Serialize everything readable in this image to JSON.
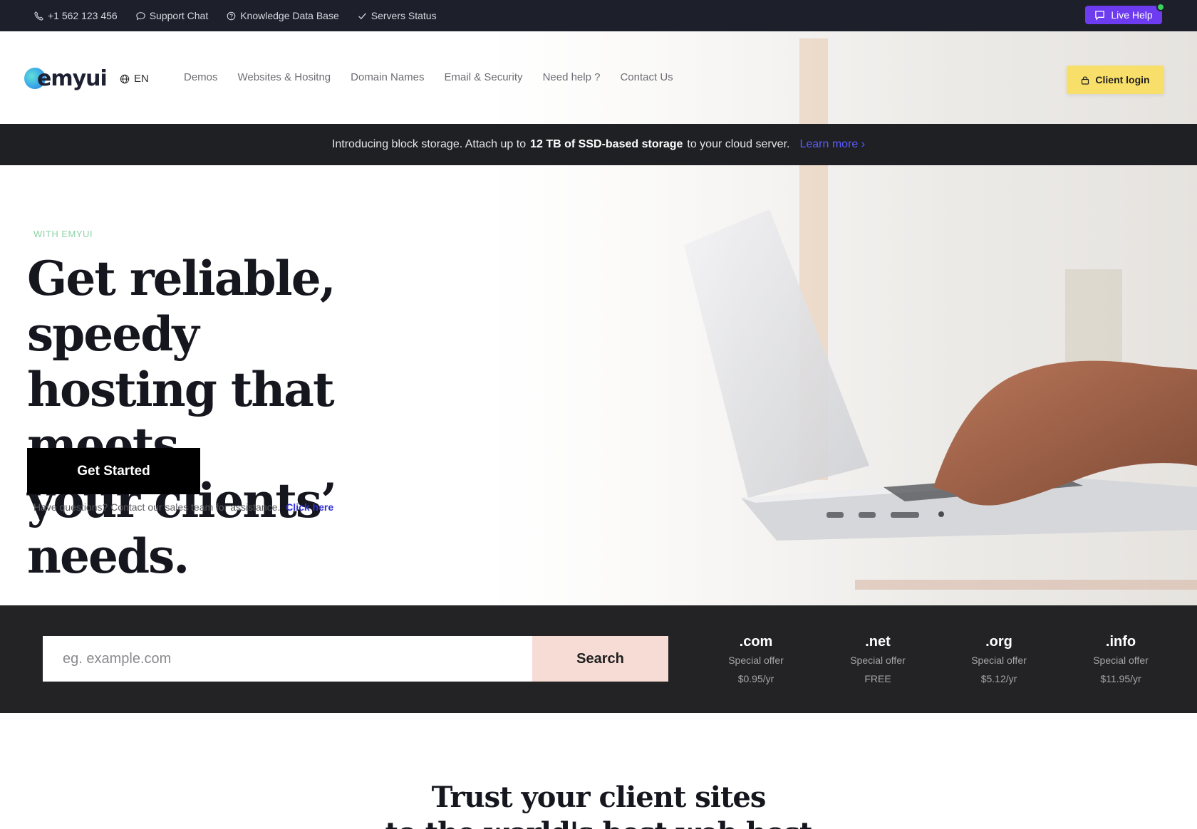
{
  "topbar": {
    "phone": "+1 562 123 456",
    "support_chat": "Support Chat",
    "knowledge_base": "Knowledge Data Base",
    "servers_status": "Servers Status",
    "live_help": "Live Help"
  },
  "header": {
    "logo_text": "emyui",
    "language": "EN",
    "nav": [
      "Demos",
      "Websites & Hositng",
      "Domain Names",
      "Email & Security",
      "Need help ?",
      "Contact Us"
    ],
    "client_login": "Client login"
  },
  "announcement": {
    "text_before": "Introducing block storage. Attach up to",
    "text_bold": "12 TB of SSD-based storage",
    "text_after": "to your cloud server.",
    "link": "Learn more ›"
  },
  "hero": {
    "eyebrow": "WITH EMYUI",
    "title_line1": "Get reliable, speedy",
    "title_line2": "hosting that meets",
    "title_line3": "your clients’ needs.",
    "cta": "Get Started",
    "note": "Have questions? Contact our sales team for assistance.",
    "note_link": "Click here"
  },
  "domain_search": {
    "placeholder": "eg. example.com",
    "button": "Search",
    "tlds": [
      {
        "ext": ".com",
        "offer": "Special offer",
        "price": "$0.95/yr"
      },
      {
        "ext": ".net",
        "offer": "Special offer",
        "price": "FREE"
      },
      {
        "ext": ".org",
        "offer": "Special offer",
        "price": "$5.12/yr"
      },
      {
        "ext": ".info",
        "offer": "Special offer",
        "price": "$11.95/yr"
      }
    ]
  },
  "trust": {
    "title": "Trust your client sites",
    "subtitle": "to the world's best web host"
  },
  "colors": {
    "topbar_bg": "#1d1f2b",
    "live_help": "#6d3cf0",
    "client_login": "#f8df6a",
    "announcement_bg": "#1f2024",
    "link_blue": "#3030d8",
    "domain_bar_bg": "#232325",
    "search_button": "#f6dcd5"
  }
}
